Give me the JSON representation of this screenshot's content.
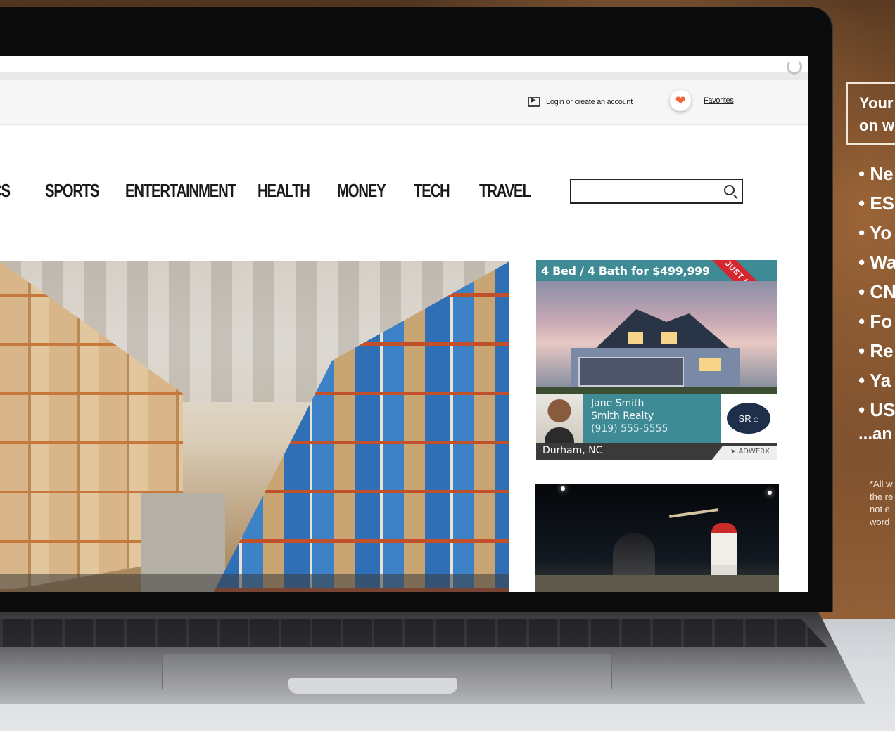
{
  "browser": {
    "refresh_icon": "refresh-icon"
  },
  "header": {
    "login_label": "Login",
    "or_text": "or",
    "create_account_label": "create an account",
    "favorites_label": "Favorites",
    "favorites_icon": "heart-icon"
  },
  "nav": {
    "items": [
      "CS",
      "SPORTS",
      "ENTERTAINMENT",
      "HEALTH",
      "MONEY",
      "TECH",
      "TRAVEL"
    ]
  },
  "search": {
    "value": "",
    "placeholder": ""
  },
  "ad": {
    "headline": "4 Bed / 4 Bath for $499,999",
    "ribbon": "JUST LISTED",
    "agent_name": "Jane Smith",
    "agency": "Smith Realty",
    "phone": "(919) 555-5555",
    "logo_text": "SR",
    "location": "Durham, NC",
    "brand": "ADWERX",
    "accent_color": "#3e8b95"
  },
  "promo": {
    "heading_line1": "Your",
    "heading_line2": "on w",
    "items": [
      "Ne",
      "ES",
      "Yo",
      "Wa",
      "CN",
      "Fo",
      "Re",
      "Ya",
      "US"
    ],
    "more": "...an",
    "note_lines": [
      "*All w",
      "the re",
      "not e",
      "word"
    ]
  }
}
